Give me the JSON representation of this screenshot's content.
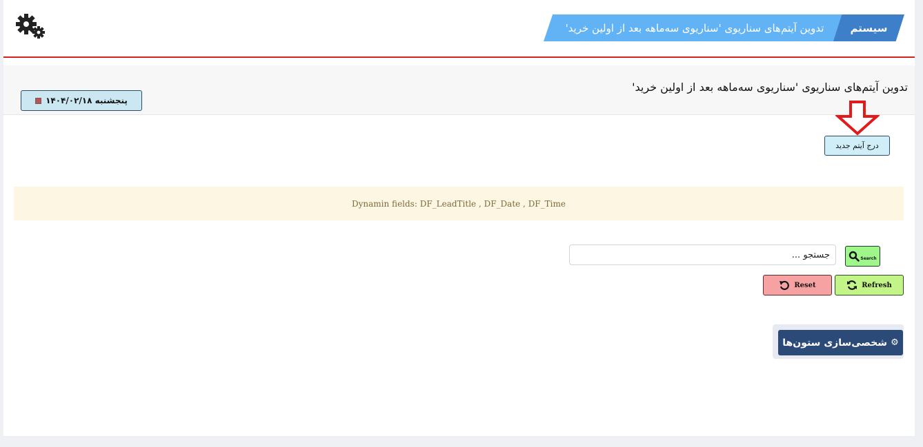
{
  "header": {
    "breadcrumb_home": "سیستم",
    "breadcrumb_current": "تدوین آیتم‌های سناریوی 'سناریوی سه‌ماهه بعد از اولین خرید'",
    "accent_color": "#d61f1f"
  },
  "title_bar": {
    "title": "تدوین آیتم‌های سناریوی 'سناریوی سه‌ماهه بعد از اولین خرید'",
    "date_label": "پنجشنبه ۱۴۰۴/۰۲/۱۸"
  },
  "actions": {
    "insert_label": "درج آیتم جدید"
  },
  "info": {
    "text": "Dynamin fields: DF_LeadTitle , DF_Date , DF_Time"
  },
  "search": {
    "placeholder": "جستجو ...",
    "button_label": "Search"
  },
  "buttons": {
    "refresh_label": "Refresh",
    "reset_label": "Reset"
  },
  "customize": {
    "label": "شخصی‌سازی ستون‌ها",
    "icon": "⚙"
  }
}
